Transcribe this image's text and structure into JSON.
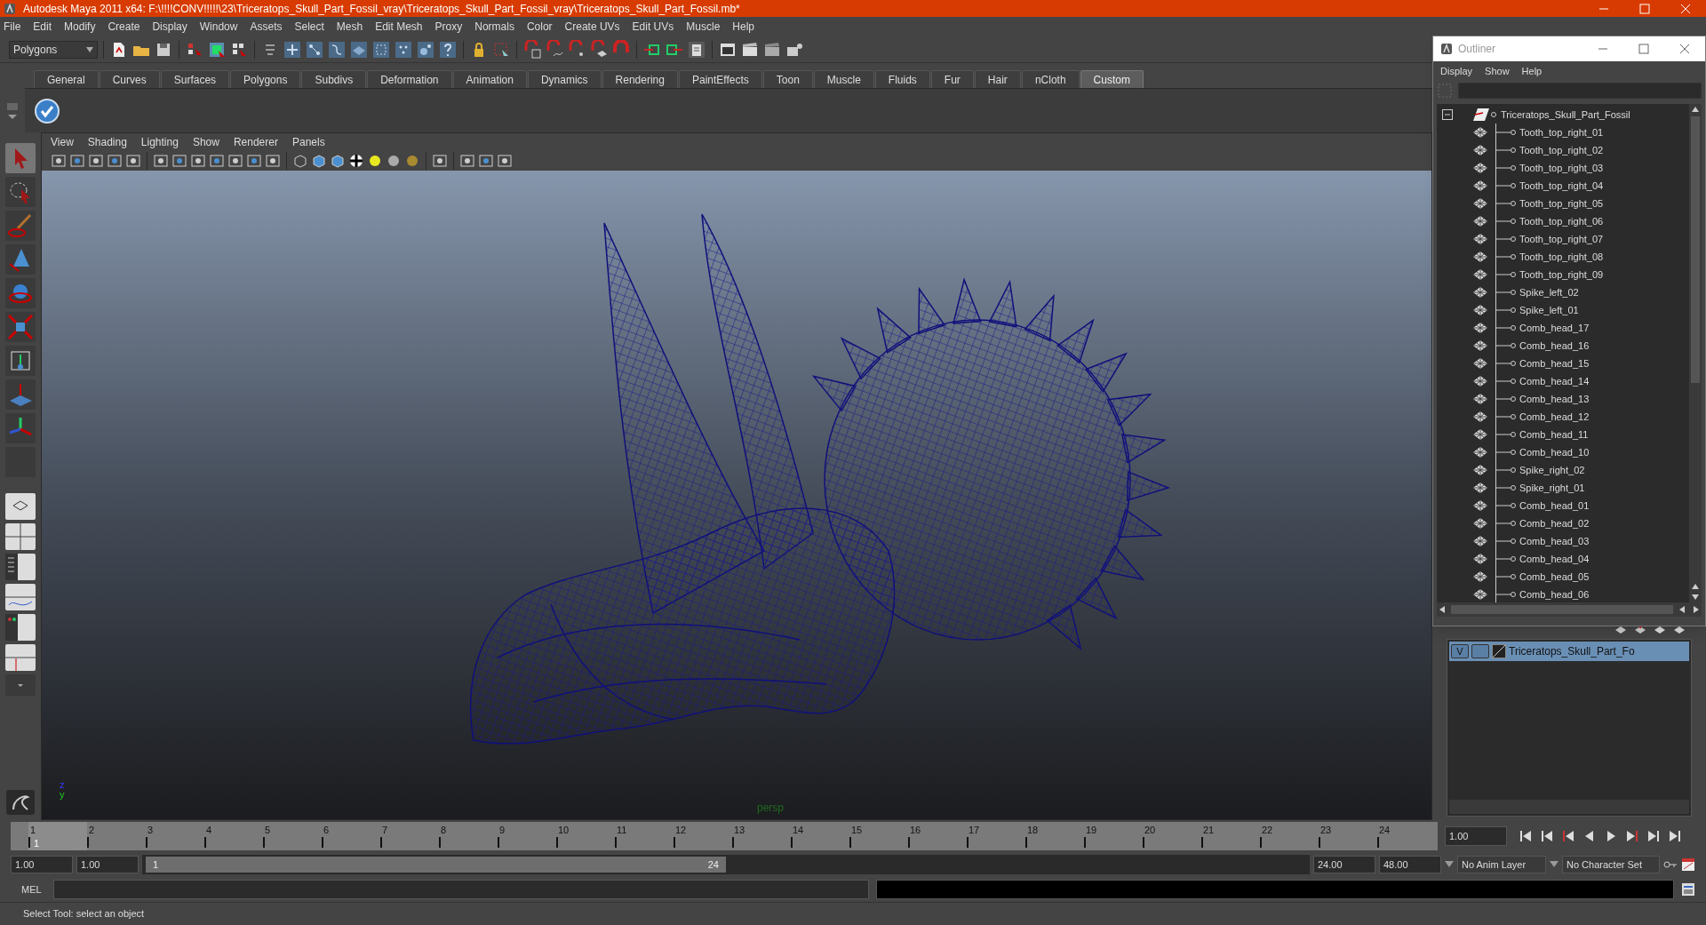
{
  "window": {
    "title": "Autodesk Maya 2011 x64: F:\\!!!!CONV!!!!!\\23\\Triceratops_Skull_Part_Fossil_vray\\Triceratops_Skull_Part_Fossil_vray\\Triceratops_Skull_Part_Fossil.mb*"
  },
  "menu_bar": [
    "File",
    "Edit",
    "Modify",
    "Create",
    "Display",
    "Window",
    "Assets",
    "Select",
    "Mesh",
    "Edit Mesh",
    "Proxy",
    "Normals",
    "Color",
    "Create UVs",
    "Edit UVs",
    "Muscle",
    "Help"
  ],
  "toolbar": {
    "mode_dropdown": "Polygons"
  },
  "shelf": {
    "tabs": [
      {
        "label": "General",
        "selected": false
      },
      {
        "label": "Curves",
        "selected": false
      },
      {
        "label": "Surfaces",
        "selected": false
      },
      {
        "label": "Polygons",
        "selected": false
      },
      {
        "label": "Subdivs",
        "selected": false
      },
      {
        "label": "Deformation",
        "selected": false
      },
      {
        "label": "Animation",
        "selected": false
      },
      {
        "label": "Dynamics",
        "selected": false
      },
      {
        "label": "Rendering",
        "selected": false
      },
      {
        "label": "PaintEffects",
        "selected": false
      },
      {
        "label": "Toon",
        "selected": false
      },
      {
        "label": "Muscle",
        "selected": false
      },
      {
        "label": "Fluids",
        "selected": false
      },
      {
        "label": "Fur",
        "selected": false
      },
      {
        "label": "Hair",
        "selected": false
      },
      {
        "label": "nCloth",
        "selected": false
      },
      {
        "label": "Custom",
        "selected": true
      }
    ]
  },
  "viewport": {
    "menu": [
      "View",
      "Shading",
      "Lighting",
      "Show",
      "Renderer",
      "Panels"
    ],
    "camera_label": "persp",
    "axis_labels": [
      "z",
      "y"
    ]
  },
  "outliner": {
    "title": "Outliner",
    "menu": [
      "Display",
      "Show",
      "Help"
    ],
    "tree": [
      {
        "label": "Triceratops_Skull_Part_Fossil",
        "expanded": true,
        "children": [
          {
            "label": "Tooth_top_right_01"
          },
          {
            "label": "Tooth_top_right_02"
          },
          {
            "label": "Tooth_top_right_03"
          },
          {
            "label": "Tooth_top_right_04"
          },
          {
            "label": "Tooth_top_right_05"
          },
          {
            "label": "Tooth_top_right_06"
          },
          {
            "label": "Tooth_top_right_07"
          },
          {
            "label": "Tooth_top_right_08"
          },
          {
            "label": "Tooth_top_right_09"
          },
          {
            "label": "Spike_left_02"
          },
          {
            "label": "Spike_left_01"
          },
          {
            "label": "Comb_head_17"
          },
          {
            "label": "Comb_head_16"
          },
          {
            "label": "Comb_head_15"
          },
          {
            "label": "Comb_head_14"
          },
          {
            "label": "Comb_head_13"
          },
          {
            "label": "Comb_head_12"
          },
          {
            "label": "Comb_head_11"
          },
          {
            "label": "Comb_head_10"
          },
          {
            "label": "Spike_right_02"
          },
          {
            "label": "Spike_right_01"
          },
          {
            "label": "Comb_head_01"
          },
          {
            "label": "Comb_head_02"
          },
          {
            "label": "Comb_head_03"
          },
          {
            "label": "Comb_head_04"
          },
          {
            "label": "Comb_head_05"
          },
          {
            "label": "Comb_head_06"
          }
        ]
      }
    ]
  },
  "layers": [
    {
      "visibility": "V",
      "label": "Triceratops_Skull_Part_Fo",
      "selected": true
    }
  ],
  "timeline": {
    "frames": [
      {
        "label": "1",
        "selected": true
      },
      {
        "label": "2",
        "selected": false
      },
      {
        "label": "3",
        "selected": false
      },
      {
        "label": "4",
        "selected": false
      },
      {
        "label": "5",
        "selected": false
      },
      {
        "label": "6",
        "selected": false
      },
      {
        "label": "7",
        "selected": false
      },
      {
        "label": "8",
        "selected": false
      },
      {
        "label": "9",
        "selected": false
      },
      {
        "label": "10",
        "selected": false
      },
      {
        "label": "11",
        "selected": false
      },
      {
        "label": "12",
        "selected": false
      },
      {
        "label": "13",
        "selected": false
      },
      {
        "label": "14",
        "selected": false
      },
      {
        "label": "15",
        "selected": false
      },
      {
        "label": "16",
        "selected": false
      },
      {
        "label": "17",
        "selected": false
      },
      {
        "label": "18",
        "selected": false
      },
      {
        "label": "19",
        "selected": false
      },
      {
        "label": "20",
        "selected": false
      },
      {
        "label": "21",
        "selected": false
      },
      {
        "label": "22",
        "selected": false
      },
      {
        "label": "23",
        "selected": false
      },
      {
        "label": "24",
        "selected": false
      }
    ],
    "current_frame_marker": "1",
    "current_time": "1.00"
  },
  "range": {
    "start": "1.00",
    "playback_start": "1.00",
    "range_slider": {
      "start": "1",
      "end": "24",
      "level": 0.5
    },
    "playback_end": "24.00",
    "end": "48.00",
    "anim_layer": "No Anim Layer",
    "character_set": "No Character Set"
  },
  "command_line": {
    "label": "MEL"
  },
  "status_bar": {
    "text": "Select Tool: select an object"
  }
}
